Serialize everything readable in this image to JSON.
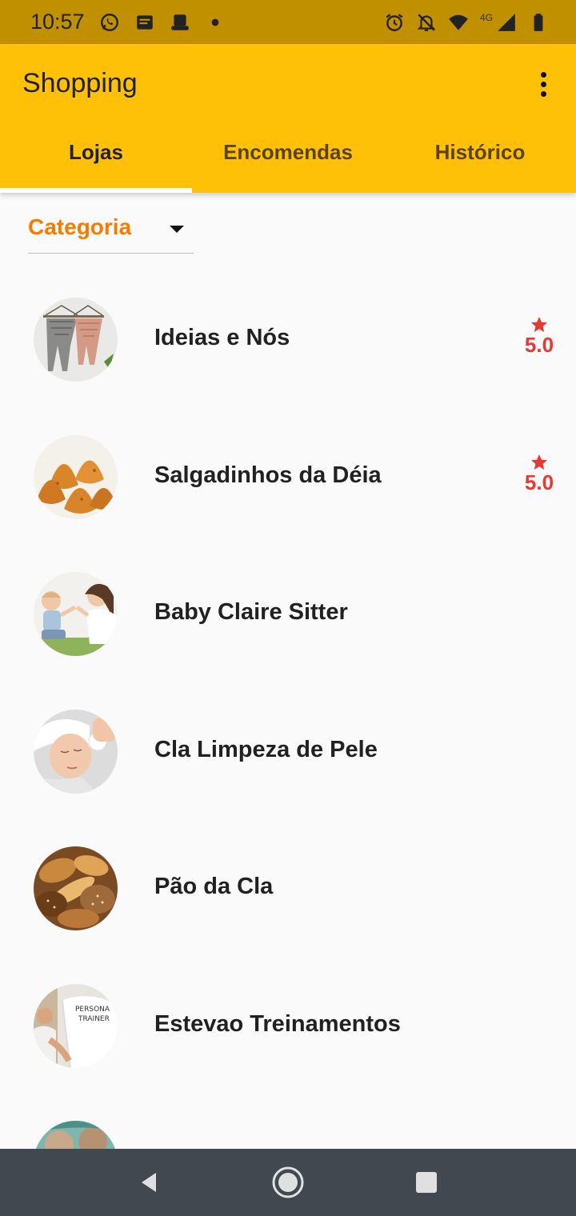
{
  "status_bar": {
    "time": "10:57",
    "network_label": "4G",
    "left_icons": [
      "whatsapp-icon",
      "message-icon",
      "app-icon",
      "dot-icon"
    ],
    "right_icons": [
      "alarm-icon",
      "bell-off-icon",
      "wifi-icon",
      "signal-icon",
      "battery-icon"
    ]
  },
  "app_bar": {
    "title": "Shopping",
    "color": "#ffc107"
  },
  "tabs": [
    {
      "label": "Lojas",
      "active": true
    },
    {
      "label": "Encomendas",
      "active": false
    },
    {
      "label": "Histórico",
      "active": false
    }
  ],
  "filter": {
    "label": "Categoria",
    "color": "#f57c00"
  },
  "stores": [
    {
      "name": "Ideias e Nós",
      "rating": "5.0",
      "image": "macrame-photo"
    },
    {
      "name": "Salgadinhos da Déia",
      "rating": "5.0",
      "image": "coxinha-photo"
    },
    {
      "name": "Baby Claire Sitter",
      "rating": null,
      "image": "baby-photo"
    },
    {
      "name": "Cla Limpeza de Pele",
      "rating": null,
      "image": "skincare-photo"
    },
    {
      "name": "Pão da Cla",
      "rating": null,
      "image": "bread-photo"
    },
    {
      "name": "Estevao Treinamentos",
      "rating": null,
      "image": "trainer-photo",
      "image_text": "PERSONAL TRAINER"
    },
    {
      "name": "",
      "rating": null,
      "image": "partial-photo"
    }
  ],
  "rating_color": "#e53935",
  "nav_bar": {
    "buttons": [
      "back-icon",
      "home-icon",
      "recents-icon"
    ]
  }
}
